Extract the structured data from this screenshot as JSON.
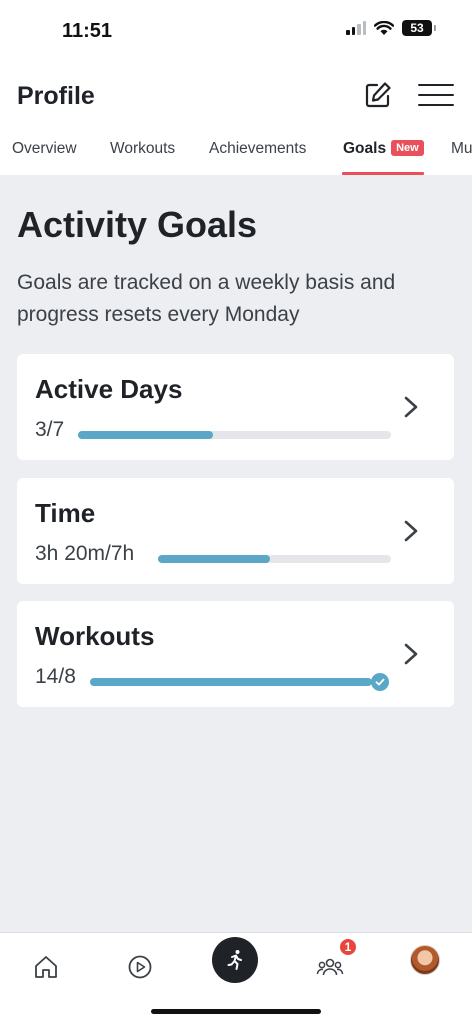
{
  "status_bar": {
    "time": "11:51",
    "battery": "53",
    "icons": [
      "cellular-signal-icon",
      "wifi-icon",
      "battery-icon"
    ]
  },
  "header": {
    "title": "Profile",
    "icons": [
      "edit-icon",
      "hamburger-menu-icon"
    ]
  },
  "tabs": [
    {
      "label": "Overview"
    },
    {
      "label": "Workouts"
    },
    {
      "label": "Achievements"
    },
    {
      "label": "Goals",
      "badge": "New",
      "active": true
    },
    {
      "label": "Mu"
    }
  ],
  "main": {
    "title": "Activity Goals",
    "description": "Goals are tracked on a weekly basis and progress resets every Monday"
  },
  "goals": [
    {
      "name": "Active Days",
      "value": "3/7",
      "progress": 0.43
    },
    {
      "name": "Time",
      "value": "3h 20m/7h",
      "progress": 0.48
    },
    {
      "name": "Workouts",
      "value": "14/8",
      "progress": 1.0,
      "completed": true
    }
  ],
  "bottom_nav": {
    "items": [
      "home-icon",
      "play-icon",
      "record-runner-icon",
      "community-icon",
      "profile-avatar"
    ],
    "community_badge": "1"
  },
  "colors": {
    "accent": "#e8505b",
    "progress": "#5aa7c8",
    "track": "#e4e6e9",
    "background": "#eceef1"
  }
}
